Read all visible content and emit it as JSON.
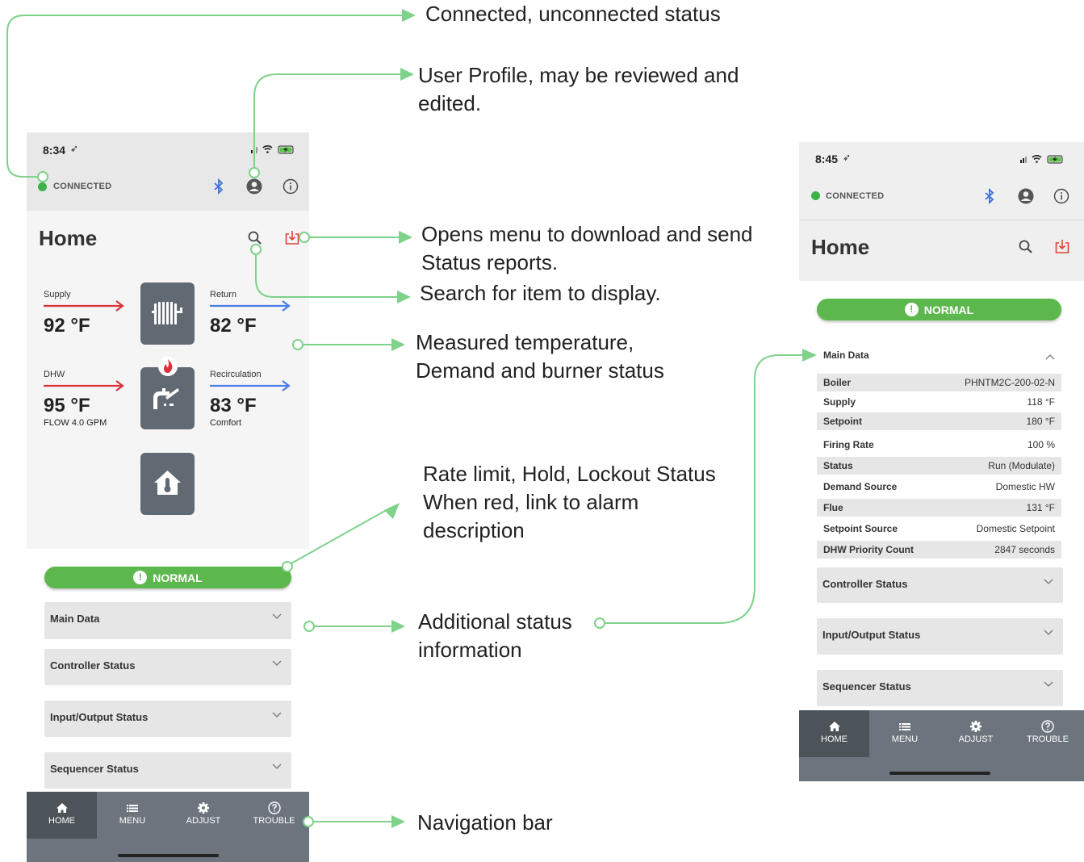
{
  "annotations": {
    "connected": "Connected, unconnected status",
    "profile_1": "User Profile, may be reviewed and",
    "profile_2": "edited.",
    "download_1": "Opens menu to download and send",
    "download_2": "Status reports.",
    "search": "Search for item to display.",
    "measured_1": "Measured temperature,",
    "measured_2": "Demand and burner status",
    "rate_1": "Rate limit, Hold, Lockout Status",
    "rate_2": "When red, link to alarm",
    "rate_3": "description",
    "additional_1": "Additional status",
    "additional_2": "information",
    "navbar": "Navigation bar"
  },
  "colors": {
    "connected_green": "#3cb34a",
    "normal_green": "#5cb74c",
    "bluetooth": "#3b6fd8",
    "arrow_red": "#d9323a",
    "arrow_blue": "#4a7ee8",
    "annotation_green": "#7ed28a",
    "download_red": "#e0403a"
  },
  "left_phone": {
    "time": "8:34",
    "connection": "CONNECTED",
    "title": "Home",
    "supply": {
      "label": "Supply",
      "value": "92 °F"
    },
    "return": {
      "label": "Return",
      "value": "82 °F"
    },
    "dhw": {
      "label": "DHW",
      "value": "95 °F",
      "sub": "FLOW 4.0 GPM"
    },
    "recirculation": {
      "label": "Recirculation",
      "value": "83 °F",
      "sub": "Comfort"
    },
    "status": "NORMAL",
    "sections": [
      "Main Data",
      "Controller Status",
      "Input/Output Status",
      "Sequencer Status"
    ],
    "nav": [
      "HOME",
      "MENU",
      "ADJUST",
      "TROUBLE"
    ]
  },
  "right_phone": {
    "time": "8:45",
    "connection": "CONNECTED",
    "title": "Home",
    "status": "NORMAL",
    "main_data_title": "Main Data",
    "main_data": [
      {
        "k": "Boiler",
        "v": "PHNTM2C-200-02-N"
      },
      {
        "k": "Supply",
        "v": "118 °F"
      },
      {
        "k": "Setpoint",
        "v": "180 °F"
      },
      {
        "k": "Firing Rate",
        "v": "100 %"
      },
      {
        "k": "Status",
        "v": "Run (Modulate)"
      },
      {
        "k": "Demand Source",
        "v": "Domestic HW"
      },
      {
        "k": "Flue",
        "v": "131 °F"
      },
      {
        "k": "Setpoint Source",
        "v": "Domestic Setpoint"
      },
      {
        "k": "DHW Priority Count",
        "v": "2847 seconds"
      }
    ],
    "sections": [
      "Controller Status",
      "Input/Output Status",
      "Sequencer Status"
    ],
    "nav": [
      "HOME",
      "MENU",
      "ADJUST",
      "TROUBLE"
    ]
  }
}
